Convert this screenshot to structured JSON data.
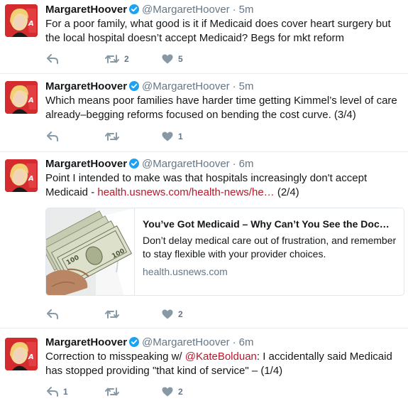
{
  "author": {
    "name": "MargaretHoover",
    "handle": "@MargaretHoover"
  },
  "tweets": [
    {
      "time": "5m",
      "text": "For a poor family, what good is it if Medicaid does cover heart surgery but the local hospital doesn’t accept Medicaid? Begs for mkt reform",
      "reply_count": "",
      "retweet_count": "2",
      "like_count": "5"
    },
    {
      "time": "5m",
      "text": "Which means poor families have harder time getting Kimmel’s level of care already–begging reforms focused on bending the cost curve. (3/4)",
      "reply_count": "",
      "retweet_count": "",
      "like_count": "1"
    },
    {
      "time": "6m",
      "text_before": "Point I intended to make was that hospitals increasingly don't accept Medicaid - ",
      "link_text": "health.usnews.com/health-news/he…",
      "text_after": " (2/4)",
      "card": {
        "title": "You’ve Got Medicaid – Why Can’t You See the Doc…",
        "description": "Don’t delay medical care out of frustration, and remember to stay flexible with your provider choices.",
        "domain": "health.usnews.com"
      },
      "reply_count": "",
      "retweet_count": "",
      "like_count": "2"
    },
    {
      "time": "6m",
      "text_before": "Correction to misspeaking w/ ",
      "mention": "@KateBolduan",
      "text_after": ": I accidentally said Medicaid has stopped providing \"that kind of service\" – (1/4)",
      "reply_count": "1",
      "retweet_count": "",
      "like_count": "2"
    }
  ],
  "icons": {
    "reply": "reply-icon",
    "retweet": "retweet-icon",
    "like": "heart-icon",
    "verified": "verified-badge-icon"
  },
  "colors": {
    "link": "#b5182b",
    "verified": "#1da1f2",
    "muted": "#657786",
    "divider": "#e6ecf0"
  }
}
